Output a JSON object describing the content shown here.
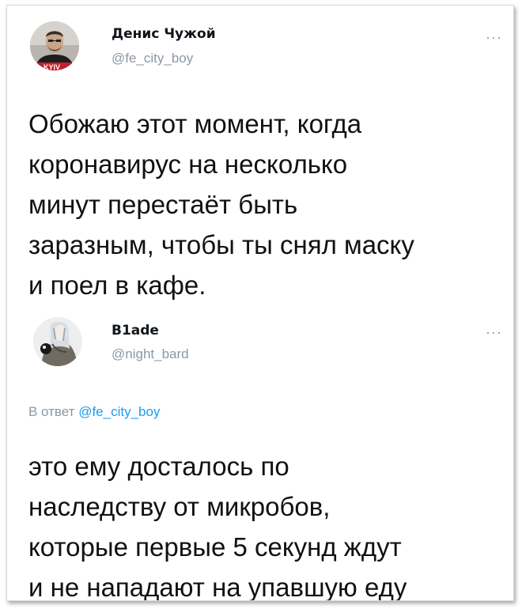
{
  "tweets": [
    {
      "author_name": "Денис Чужой",
      "author_handle": "@fe_city_boy",
      "avatar_icon": "user-avatar-photo",
      "avatar_shirt_text": "KYIV",
      "more_icon": "more-dots-icon",
      "more_label": "···",
      "text": "Обожаю этот момент, когда\nкоронавирус на несколько\nминут перестаёт быть\nзаразным, чтобы ты снял маску\nи поел в кафе."
    },
    {
      "author_name": "B1ade",
      "author_handle": "@night_bard",
      "avatar_icon": "user-avatar-illustration",
      "more_icon": "more-dots-icon",
      "more_label": "···",
      "reply_prefix": "В ответ",
      "reply_handle": "@fe_city_boy",
      "text": "это ему досталось по\nнаследству от микробов,\nкоторые первые 5 секунд ждут\nи не нападают на упавшую еду"
    }
  ],
  "colors": {
    "text": "#0f1419",
    "secondary": "#8b98a5",
    "link": "#1d9bf0",
    "background": "#ffffff"
  }
}
